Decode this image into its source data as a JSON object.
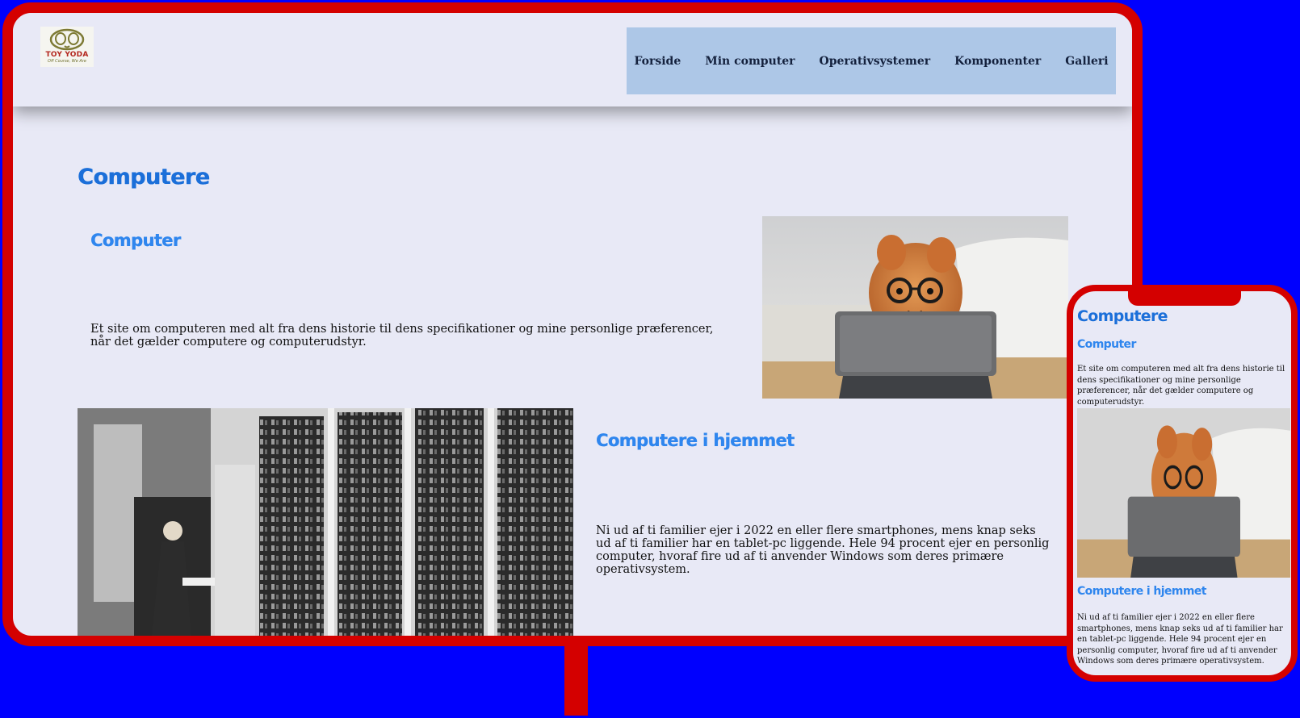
{
  "brand": {
    "name": "TOY YODA",
    "tagline": "Off Course, We Are"
  },
  "nav": {
    "items": [
      "Forside",
      "Min computer",
      "Operativsystemer",
      "Komponenter",
      "Galleri"
    ]
  },
  "page": {
    "title": "Computere",
    "section1": {
      "title": "Computer",
      "text": "Et site om computeren med alt fra dens historie til dens specifikationer og mine personlige præferencer, når det gælder computere og computerudstyr."
    },
    "section2": {
      "title": "Computere i hjemmet",
      "text": "Ni ud af ti familier ejer i 2022 en eller flere smartphones, mens knap seks ud af ti familier har en tablet-pc liggende. Hele 94 procent ejer en personlig computer, hvoraf fire ud af ti anvender Windows som deres primære operativsystem."
    }
  },
  "colors": {
    "background": "#0000fe",
    "device_frame": "#d40000",
    "page_bg": "#e8e9f6",
    "nav_bg": "#adc7e7",
    "heading": "#1b6fd9",
    "subheading": "#2f86ee"
  },
  "images": {
    "dog": "dog-with-glasses-using-tablet-photo",
    "mainframe": "vintage-mainframe-computer-photo"
  }
}
